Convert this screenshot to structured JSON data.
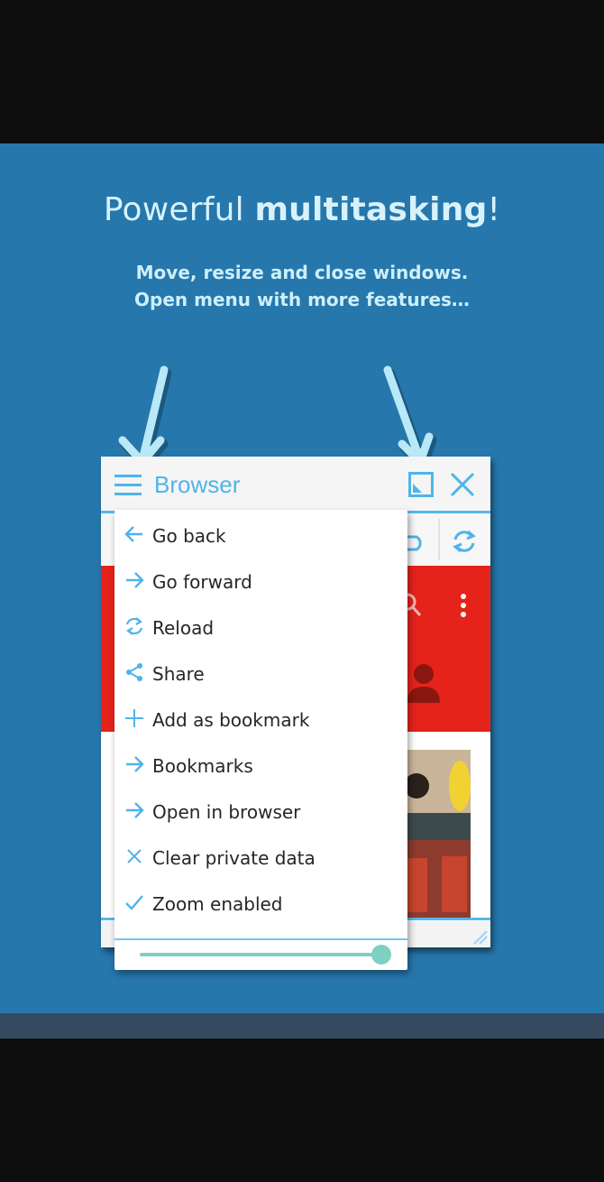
{
  "promo": {
    "title_prefix": "Powerful ",
    "title_bold": "multitasking",
    "title_suffix": "!",
    "subtitle_line1": "Move, resize and close windows.",
    "subtitle_line2": "Open menu with more features…"
  },
  "window": {
    "title": "Browser",
    "icons": [
      "menu-icon",
      "resize-icon",
      "close-icon",
      "undo-icon",
      "refresh-icon",
      "search-icon",
      "overflow-icon",
      "user-icon"
    ]
  },
  "menu": {
    "items": [
      {
        "label": "Go back",
        "icon": "arrow-left-icon"
      },
      {
        "label": "Go forward",
        "icon": "arrow-right-icon"
      },
      {
        "label": "Reload",
        "icon": "reload-icon"
      },
      {
        "label": "Share",
        "icon": "share-icon"
      },
      {
        "label": "Add as bookmark",
        "icon": "plus-icon"
      },
      {
        "label": "Bookmarks",
        "icon": "arrow-right-icon"
      },
      {
        "label": "Open in browser",
        "icon": "arrow-right-icon"
      },
      {
        "label": "Clear private data",
        "icon": "x-icon"
      },
      {
        "label": "Zoom enabled",
        "icon": "check-icon"
      }
    ],
    "zoom_slider_value": 1.0
  },
  "colors": {
    "background": "#2677ac",
    "accent": "#55b8ec",
    "page_header_red": "#e5231b",
    "slider": "#7fcfc3"
  }
}
